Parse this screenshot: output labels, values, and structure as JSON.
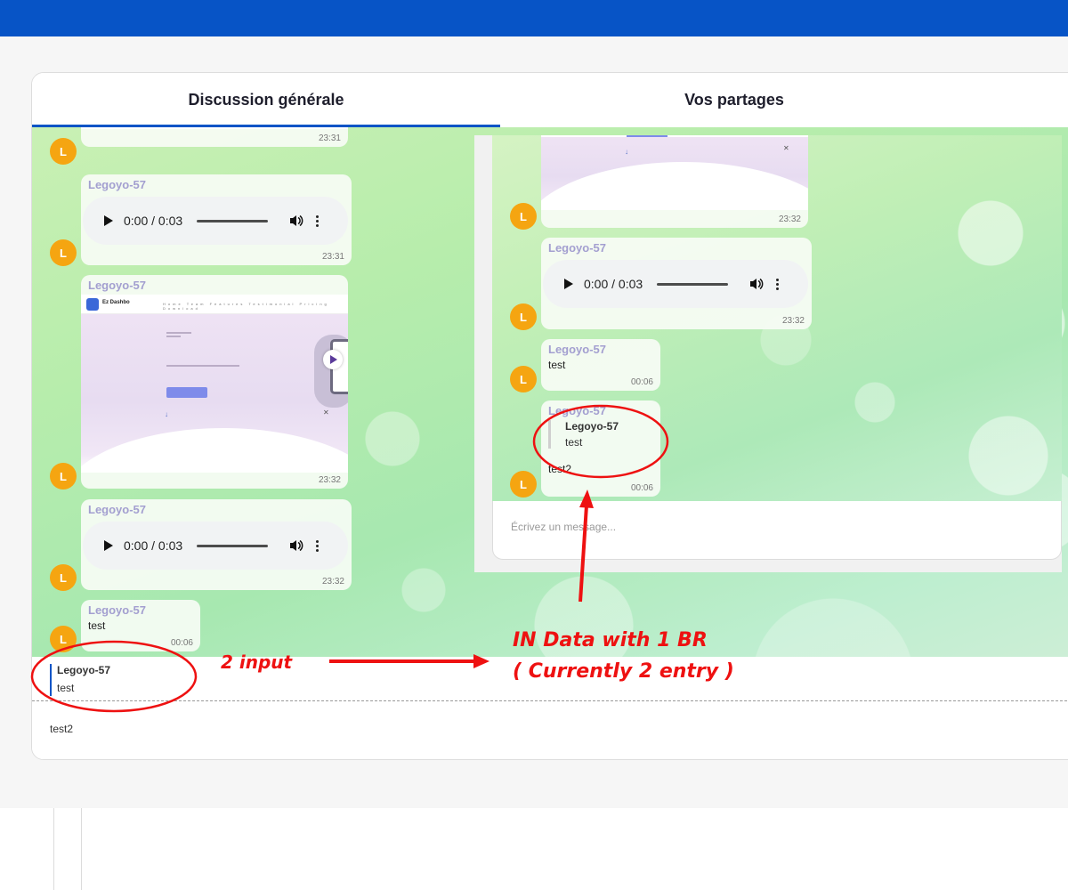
{
  "tabs": [
    {
      "label": "Discussion générale",
      "active": true
    },
    {
      "label": "Vos partages",
      "active": false
    }
  ],
  "avatar_initial": "L",
  "author": "Legoyo-57",
  "audio_time": "0:00 / 0:03",
  "main_chat": {
    "msg1_time": "23:31",
    "msg2_time": "23:31",
    "msg3_time": "23:32",
    "msg4_time": "23:32",
    "msg5_text": "test",
    "msg5_time": "00:06"
  },
  "shared_chat": {
    "msg1_time": "23:32",
    "msg2_time": "23:32",
    "msg3_text": "test",
    "msg3_time": "00:06",
    "msg4_quote_author": "Legoyo-57",
    "msg4_quote_text": "test",
    "msg4_text": "test2",
    "msg4_time": "00:06",
    "input_placeholder": "Écrivez un message..."
  },
  "screenshot_preview": {
    "brand": "Ez Dashbo",
    "nav_links": "Home   Team   Features   Testimonial   Pricing   Download"
  },
  "reply_preview": {
    "author": "Legoyo-57",
    "text": "test"
  },
  "compose_value": "test2",
  "annotations": {
    "left_label": "2 input",
    "right_line1": "IN Data with 1 BR",
    "right_line2": "( Currently 2 entry )",
    "color": "#ee1111"
  },
  "colors": {
    "primary": "#0754c6",
    "avatar": "#f5a511",
    "author": "#a39fd0"
  }
}
